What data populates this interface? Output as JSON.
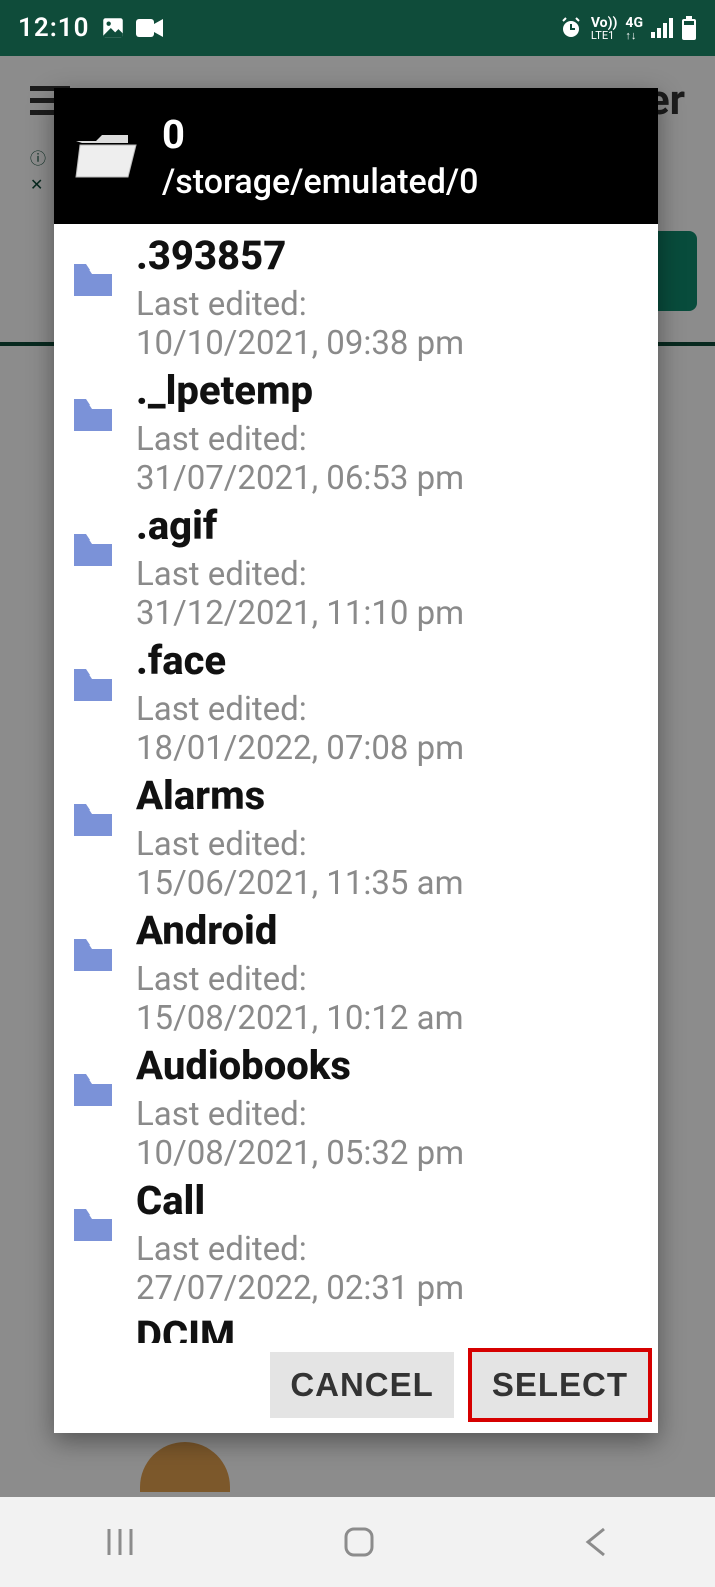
{
  "status": {
    "time": "12:10",
    "network_label_top": "Vo))",
    "network_label_bottom": "LTE1",
    "network_gen": "4G"
  },
  "backdrop": {
    "app_title_fragment": "er"
  },
  "dialog": {
    "current_dir": "0",
    "current_path": "/storage/emulated/0",
    "last_edited_label": "Last edited:",
    "items": [
      {
        "name": ".393857",
        "date": "10/10/2021, 09:38 pm"
      },
      {
        "name": "._lpetemp",
        "date": "31/07/2021, 06:53 pm"
      },
      {
        "name": ".agif",
        "date": "31/12/2021, 11:10 pm"
      },
      {
        "name": ".face",
        "date": "18/01/2022, 07:08 pm"
      },
      {
        "name": "Alarms",
        "date": "15/06/2021, 11:35 am"
      },
      {
        "name": "Android",
        "date": "15/08/2021, 10:12 am"
      },
      {
        "name": "Audiobooks",
        "date": "10/08/2021, 05:32 pm"
      },
      {
        "name": "Call",
        "date": "27/07/2022, 02:31 pm"
      },
      {
        "name": "DCIM",
        "date": ""
      }
    ],
    "cancel_label": "CANCEL",
    "select_label": "SELECT"
  }
}
